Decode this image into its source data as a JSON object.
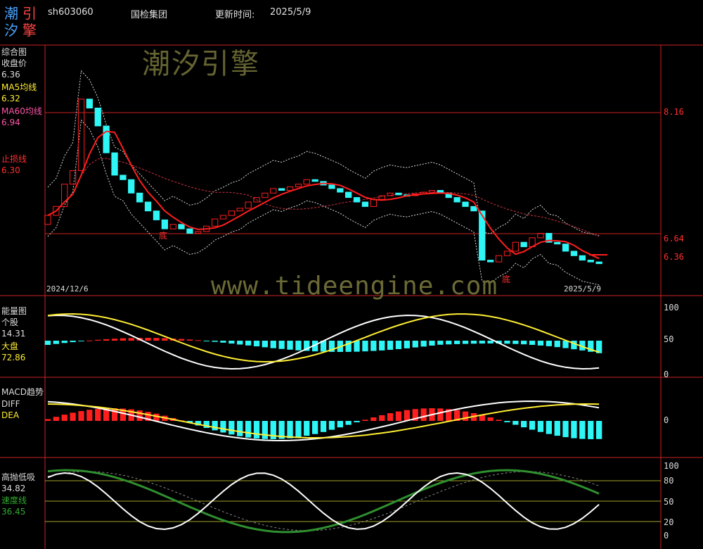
{
  "header": {
    "logo_chars": [
      "潮",
      "引",
      "汐",
      "擎"
    ],
    "symbol": "sh603060",
    "name": "国检集团",
    "update_label": "更新时间:",
    "update_date": "2025/5/9"
  },
  "watermark": {
    "brand": "潮汐引擎",
    "url": "www.tideengine.com"
  },
  "colors": {
    "up": "#ff1e1e",
    "down": "#2ef6f6",
    "ma": "#ff1e1e",
    "white": "#ffffff",
    "yellow": "#ffee33",
    "green": "#2f8f2f",
    "grid": "#cc2222",
    "axis": "#cc2222",
    "dotted": "#dddddd"
  },
  "panels": {
    "main": {
      "title": "综合图",
      "close_label": "收盘价",
      "close_value": "6.36",
      "ma5_label": "MA5均线",
      "ma5_value": "6.32",
      "ma60_label": "MA60均线",
      "ma60_value": "6.94",
      "stop_label": "止损线",
      "stop_value": "6.30",
      "price_levels": [
        "8.16",
        "6.64",
        "6.36"
      ],
      "date_start": "2024/12/6",
      "date_end": "2025/5/9",
      "bottom_marks": [
        "底",
        "底"
      ]
    },
    "energy": {
      "title": "能量图",
      "stock_label": "个股",
      "stock_value": "14.31",
      "market_label": "大盘",
      "market_value": "72.86",
      "scale": [
        "100",
        "50",
        "0"
      ]
    },
    "macd": {
      "title": "MACD趋势",
      "diff_label": "DIFF",
      "dea_label": "DEA",
      "scale": [
        "0"
      ]
    },
    "highlow": {
      "title": "高抛低吸",
      "value": "34.82",
      "speed_label": "速度线",
      "speed_value": "36.45",
      "scale": [
        "100",
        "80",
        "50",
        "20",
        "0"
      ]
    }
  },
  "chart_data": [
    {
      "type": "candlestick",
      "series": "close",
      "values": [
        6.9,
        7.0,
        7.25,
        7.4,
        8.2,
        8.1,
        7.9,
        7.6,
        7.35,
        7.3,
        7.15,
        7.05,
        6.95,
        6.85,
        6.75,
        6.8,
        6.75,
        6.7,
        6.72,
        6.78,
        6.86,
        6.9,
        6.95,
        6.98,
        7.05,
        7.1,
        7.15,
        7.2,
        7.18,
        7.22,
        7.25,
        7.3,
        7.28,
        7.24,
        7.2,
        7.16,
        7.1,
        7.05,
        7.0,
        7.08,
        7.12,
        7.15,
        7.13,
        7.12,
        7.14,
        7.16,
        7.18,
        7.15,
        7.1,
        7.05,
        7.0,
        6.95,
        6.4,
        6.38,
        6.45,
        6.5,
        6.6,
        6.55,
        6.65,
        6.7,
        6.6,
        6.58,
        6.5,
        6.45,
        6.4,
        6.38,
        6.36
      ]
    },
    {
      "type": "bar",
      "series": "energy-stock",
      "values": [
        14.31
      ]
    },
    {
      "type": "line",
      "series": "energy-market",
      "values": [
        72.86
      ]
    },
    {
      "type": "line",
      "series": "highlow",
      "values": [
        34.82
      ]
    },
    {
      "type": "line",
      "series": "speed",
      "values": [
        36.45
      ]
    }
  ]
}
